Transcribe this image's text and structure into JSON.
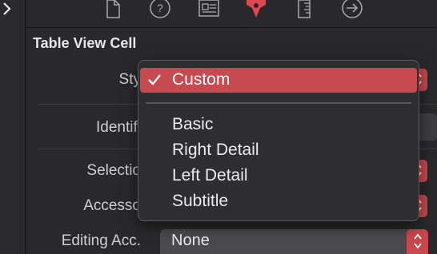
{
  "toolbar": {
    "icons": [
      "file-icon",
      "help-icon",
      "identity-icon",
      "attributes-icon",
      "size-icon",
      "connections-icon"
    ],
    "active": "attributes-icon",
    "accent": "#e0474e"
  },
  "section": {
    "title": "Table View Cell"
  },
  "rows": {
    "style_label": "Sty",
    "identifier_label": "Identifi",
    "selection_label": "Selectio",
    "accessory_label": "Accesso",
    "editing_label": "Editing Acc.",
    "editing_value": "None"
  },
  "style_menu": {
    "selected": "Custom",
    "options": [
      "Basic",
      "Right Detail",
      "Left Detail",
      "Subtitle"
    ],
    "highlight_color": "#c64a4f"
  }
}
